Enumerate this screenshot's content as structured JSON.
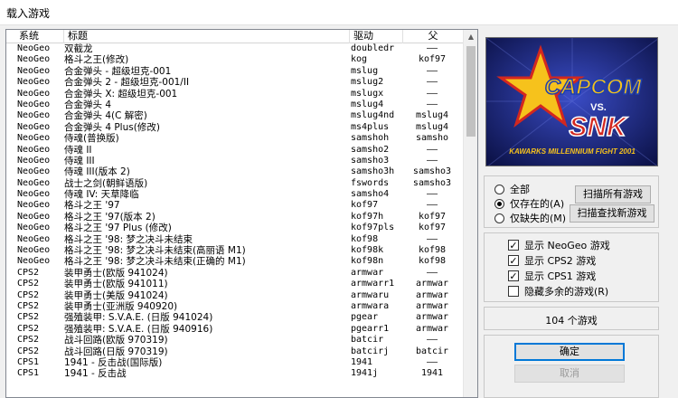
{
  "window": {
    "title": "载入游戏"
  },
  "list": {
    "columns": {
      "system": "系统",
      "title": "标题",
      "driver": "驱动",
      "parent": "父"
    },
    "rows": [
      {
        "system": "NeoGeo",
        "title": "双截龙",
        "driver": "doubledr",
        "parent": "——"
      },
      {
        "system": "NeoGeo",
        "title": "格斗之王(修改)",
        "driver": "kog",
        "parent": "kof97"
      },
      {
        "system": "NeoGeo",
        "title": "合金弹头 - 超级坦克-001",
        "driver": "mslug",
        "parent": "——"
      },
      {
        "system": "NeoGeo",
        "title": "合金弹头 2 - 超级坦克-001/II",
        "driver": "mslug2",
        "parent": "——"
      },
      {
        "system": "NeoGeo",
        "title": "合金弹头 X: 超级坦克-001",
        "driver": "mslugx",
        "parent": "——"
      },
      {
        "system": "NeoGeo",
        "title": "合金弹头 4",
        "driver": "mslug4",
        "parent": "——"
      },
      {
        "system": "NeoGeo",
        "title": "合金弹头 4(C 解密)",
        "driver": "mslug4nd",
        "parent": "mslug4"
      },
      {
        "system": "NeoGeo",
        "title": "合金弹头 4 Plus(修改)",
        "driver": "ms4plus",
        "parent": "mslug4"
      },
      {
        "system": "NeoGeo",
        "title": "侍魂(普换版)",
        "driver": "samshoh",
        "parent": "samsho"
      },
      {
        "system": "NeoGeo",
        "title": "侍魂 II",
        "driver": "samsho2",
        "parent": "——"
      },
      {
        "system": "NeoGeo",
        "title": "侍魂 III",
        "driver": "samsho3",
        "parent": "——"
      },
      {
        "system": "NeoGeo",
        "title": "侍魂 III(版本 2)",
        "driver": "samsho3h",
        "parent": "samsho3"
      },
      {
        "system": "NeoGeo",
        "title": "战士之剑(朝鲜语版)",
        "driver": "fswords",
        "parent": "samsho3"
      },
      {
        "system": "NeoGeo",
        "title": "侍魂 IV: 天草降临",
        "driver": "samsho4",
        "parent": "——"
      },
      {
        "system": "NeoGeo",
        "title": "格斗之王 '97",
        "driver": "kof97",
        "parent": "——"
      },
      {
        "system": "NeoGeo",
        "title": "格斗之王 '97(版本 2)",
        "driver": "kof97h",
        "parent": "kof97"
      },
      {
        "system": "NeoGeo",
        "title": "格斗之王 '97 Plus (修改)",
        "driver": "kof97pls",
        "parent": "kof97"
      },
      {
        "system": "NeoGeo",
        "title": "格斗之王 '98: 梦之决斗未结束",
        "driver": "kof98",
        "parent": "——"
      },
      {
        "system": "NeoGeo",
        "title": "格斗之王 '98: 梦之决斗未结束(高丽语 M1)",
        "driver": "kof98k",
        "parent": "kof98"
      },
      {
        "system": "NeoGeo",
        "title": "格斗之王 '98: 梦之决斗未结束(正确的 M1)",
        "driver": "kof98n",
        "parent": "kof98"
      },
      {
        "system": "CPS2",
        "title": "装甲勇士(欧版 941024)",
        "driver": "armwar",
        "parent": "——"
      },
      {
        "system": "CPS2",
        "title": "装甲勇士(欧版 941011)",
        "driver": "armwarr1",
        "parent": "armwar"
      },
      {
        "system": "CPS2",
        "title": "装甲勇士(美版 941024)",
        "driver": "armwaru",
        "parent": "armwar"
      },
      {
        "system": "CPS2",
        "title": "装甲勇士(亚洲版 940920)",
        "driver": "armwara",
        "parent": "armwar"
      },
      {
        "system": "CPS2",
        "title": "强殖装甲: S.V.A.E. (日版 941024)",
        "driver": "pgear",
        "parent": "armwar"
      },
      {
        "system": "CPS2",
        "title": "强殖装甲: S.V.A.E. (日版 940916)",
        "driver": "pgearr1",
        "parent": "armwar"
      },
      {
        "system": "CPS2",
        "title": "战斗回路(欧版 970319)",
        "driver": "batcir",
        "parent": "——"
      },
      {
        "system": "CPS2",
        "title": "战斗回路(日版 970319)",
        "driver": "batcirj",
        "parent": "batcir"
      },
      {
        "system": "CPS1",
        "title": "1941 - 反击战(国际版)",
        "driver": "1941",
        "parent": "——"
      },
      {
        "system": "CPS1",
        "title": "1941 - 反击战",
        "driver": "1941j",
        "parent": "1941"
      }
    ]
  },
  "preview": {
    "logo_top": "CAPCOM",
    "logo_vs": "VS.",
    "logo_bottom": "SNK",
    "subtitle": "KAWARKS MILLENNIUM FIGHT 2001"
  },
  "filter": {
    "radio_all": "全部",
    "radio_existing": "仅存在的(A)",
    "radio_missing": "仅缺失的(M)",
    "selected": "radio_existing",
    "scan_all": "扫描所有游戏",
    "scan_new": "扫描查找新游戏"
  },
  "options": {
    "show_neogeo": "显示 NeoGeo 游戏",
    "show_cps2": "显示 CPS2 游戏",
    "show_cps1": "显示 CPS1 游戏",
    "hide_extra": "隐藏多余的游戏(R)",
    "checked": {
      "show_neogeo": true,
      "show_cps2": true,
      "show_cps1": true,
      "hide_extra": false
    }
  },
  "status": {
    "game_count": "104 个游戏"
  },
  "buttons": {
    "ok": "确定",
    "cancel": "取消"
  },
  "colors": {
    "logo_yellow": "#f6c21c",
    "logo_red": "#d3271f",
    "logo_blue": "#1d3fb0",
    "preview_bg": "#0c1248",
    "focus_blue": "#0078d7"
  }
}
